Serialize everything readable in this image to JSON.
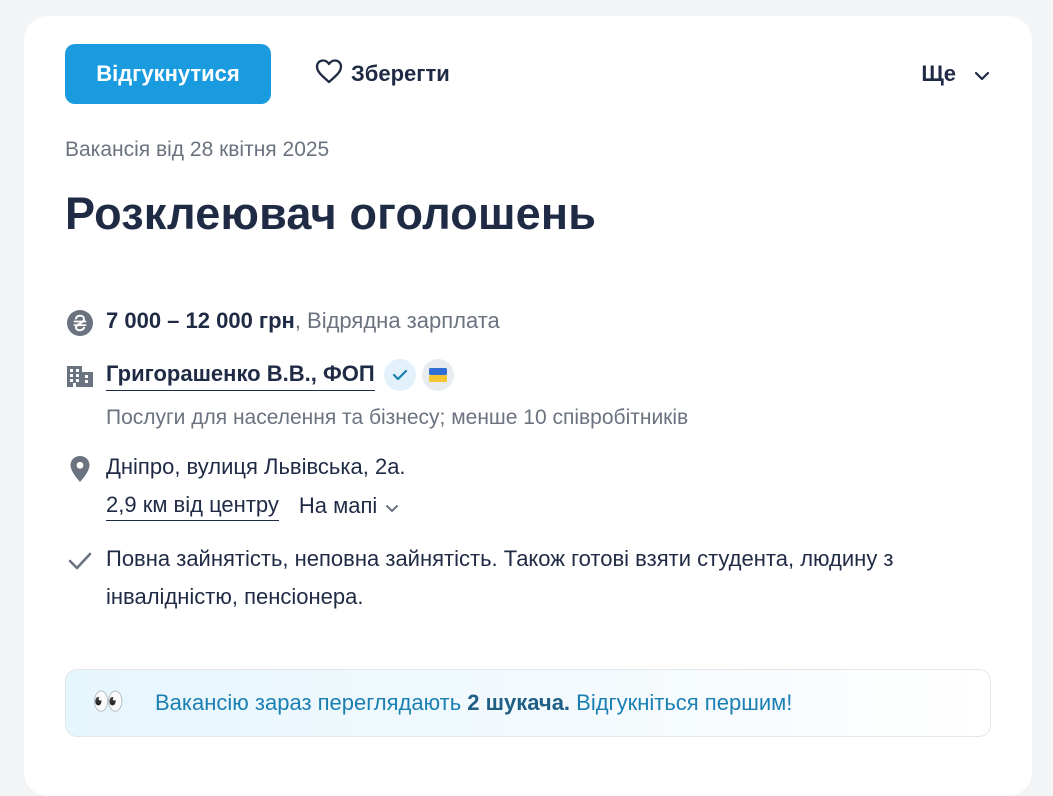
{
  "toolbar": {
    "apply_label": "Відгукнутися",
    "save_label": "Зберегти",
    "more_label": "Ще"
  },
  "vacancy": {
    "date": "Вакансія від 28 квітня 2025",
    "title": "Розклеювач оголошень",
    "salary": "7 000 – 12 000 грн",
    "salary_note": ", Відрядна зарплата",
    "company": "Григорашенко В.В., ФОП",
    "company_desc": "Послуги для населення та бізнесу; менше 10 співробітників",
    "address": "Дніпро, вулиця Львівська, 2а.",
    "distance": "2,9 км від центру",
    "map_label": "На мапі",
    "employment": "Повна зайнятість, неповна зайнятість. Також готові взяти студента, людину з інвалідністю, пенсіонера."
  },
  "notice": {
    "emoji": "👀",
    "before": "Вакансію зараз переглядають ",
    "count": "2 шукача.",
    "after": " Відгукніться першим!"
  },
  "colors": {
    "accent": "#1a9be0",
    "text": "#1f2a44",
    "muted": "#6b7380",
    "notice_text": "#1a7fb3"
  }
}
